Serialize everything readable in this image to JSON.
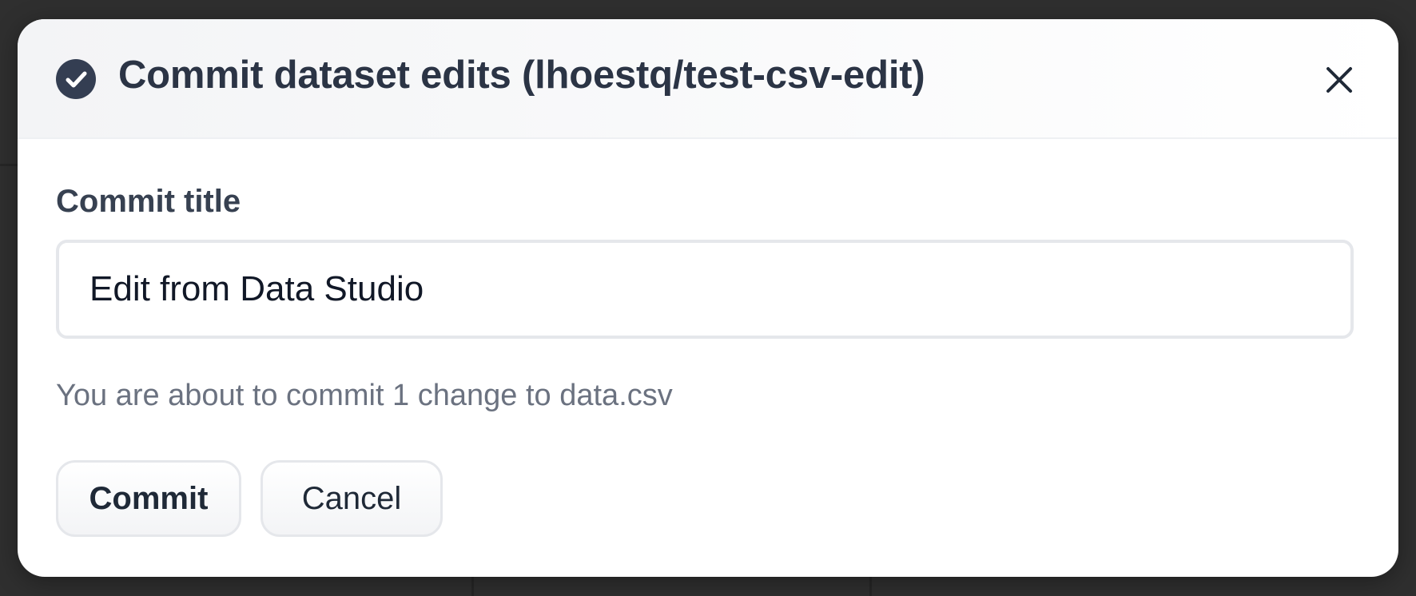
{
  "modal": {
    "title": "Commit dataset edits (lhoestq/test-csv-edit)",
    "title_icon": "check-circle-icon",
    "close_icon": "close-icon"
  },
  "form": {
    "label": "Commit title",
    "input_value": "Edit from Data Studio",
    "helper": "You are about to commit 1 change to data.csv"
  },
  "actions": {
    "commit_label": "Commit",
    "cancel_label": "Cancel"
  },
  "colors": {
    "accent_dark": "#343e52",
    "text_primary": "#2b3445",
    "text_muted": "#6b7280",
    "border": "#e5e7eb"
  }
}
